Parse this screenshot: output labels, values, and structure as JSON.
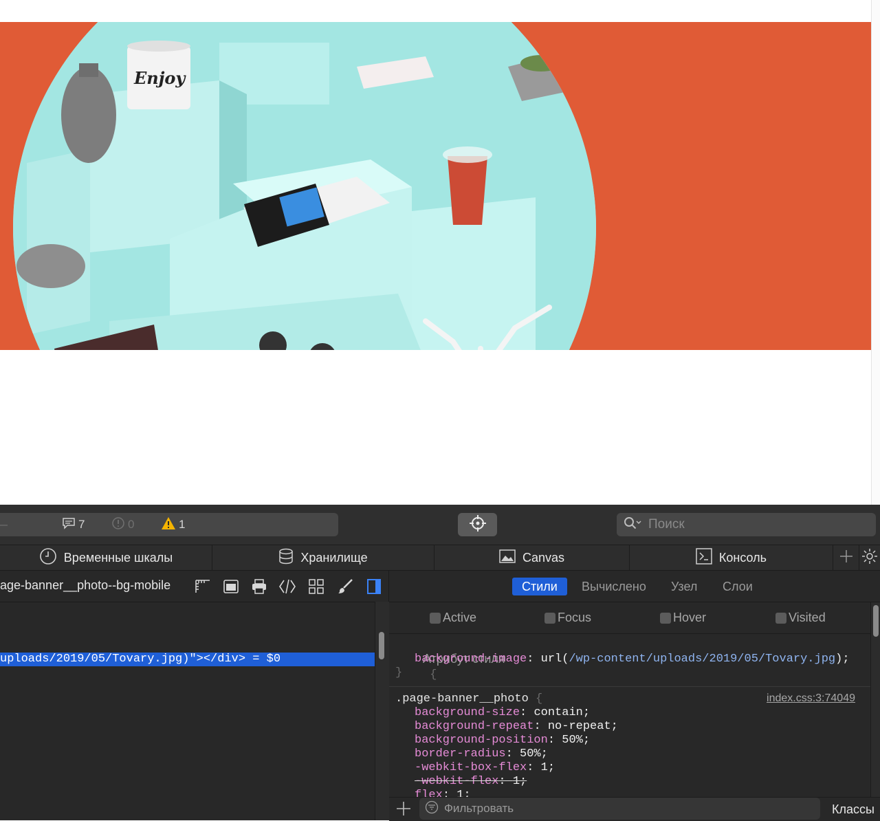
{
  "toolbar": {
    "left_fragment": "—",
    "messages_count": "7",
    "errors_count": "0",
    "warnings_count": "1",
    "search_placeholder": "Поиск"
  },
  "tabs": [
    {
      "label": "Временные шкалы",
      "icon": "clock-icon"
    },
    {
      "label": "Хранилище",
      "icon": "database-icon"
    },
    {
      "label": "Canvas",
      "icon": "image-icon"
    },
    {
      "label": "Консоль",
      "icon": "console-icon"
    }
  ],
  "dom": {
    "breadcrumb": "age-banner__photo--bg-mobile",
    "selected_line": "uploads/2019/05/Tovary.jpg)\"></div> = $0"
  },
  "styles_panel": {
    "tabs": [
      "Стили",
      "Вычислено",
      "Узел",
      "Слои"
    ],
    "pseudo_classes": [
      "Active",
      "Focus",
      "Hover",
      "Visited"
    ],
    "style_attribute": {
      "label": "Атрибут стиля",
      "prop": "background-image",
      "value_prefix": "url(",
      "value_url": "/wp-content/uploads/2019/05/Tovary.jpg",
      "value_suffix": ");"
    },
    "rule": {
      "selector": ".page-banner__photo",
      "source": "index.css:3:74049",
      "declarations": [
        {
          "prop": "background-size",
          "value": "contain;",
          "struck": false
        },
        {
          "prop": "background-repeat",
          "value": "no-repeat;",
          "struck": false
        },
        {
          "prop": "background-position",
          "value": "50%;",
          "struck": false
        },
        {
          "prop": "border-radius",
          "value": "50%;",
          "struck": false
        },
        {
          "prop": "-webkit-box-flex",
          "value": "1;",
          "struck": false
        },
        {
          "prop": "-webkit-flex",
          "value": "1;",
          "struck": true
        },
        {
          "prop": "flex",
          "value": "1;",
          "struck": false
        }
      ]
    },
    "filter_placeholder": "Фильтровать",
    "classes_label": "Классы"
  },
  "colors": {
    "banner_bg": "#e05b36",
    "selection": "#1f5fd7",
    "css_property": "#e58bd6",
    "css_url": "#8fb4f0",
    "warning": "#f5b400"
  }
}
